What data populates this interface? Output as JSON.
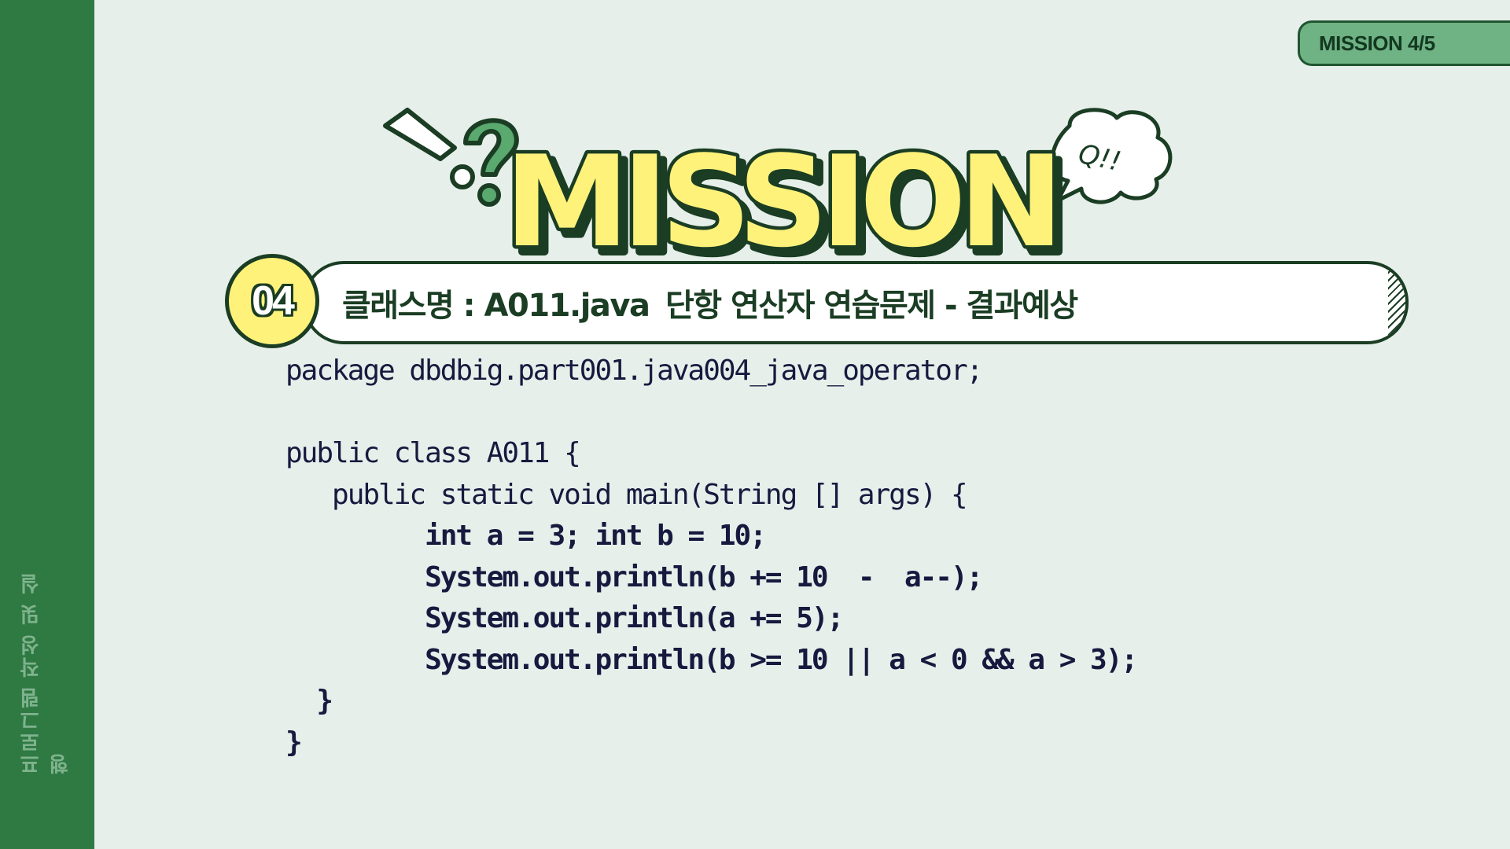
{
  "sidebar": {
    "label": "프로그램 작성 및 실행"
  },
  "badge": {
    "text": "MISSION 4/5"
  },
  "hero": {
    "title": "MISSION",
    "bubble": "Q!!"
  },
  "header": {
    "number": "04",
    "title": "클래스명 : A011.java",
    "subtitle": "단항 연산자 연습문제 - 결과예상"
  },
  "code": {
    "lines": [
      "package dbdbig.part001.java004_java_operator;",
      "",
      "public class A011 {",
      "   public static void main(String [] args) {",
      "         int a = 3; int b = 10;",
      "         System.out.println(b += 10  -  a--);",
      "         System.out.println(a += 5);",
      "         System.out.println(b >= 10 || a < 0 && a > 3);",
      "  }",
      "}"
    ]
  },
  "colors": {
    "background": "#e6efea",
    "sidebar": "#2f7a43",
    "accent_yellow": "#fff27a",
    "dark_green": "#1a3d23",
    "code_text": "#161a3e"
  }
}
